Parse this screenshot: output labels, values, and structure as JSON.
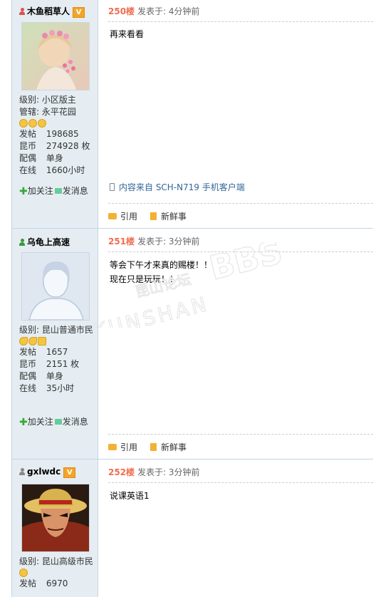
{
  "posts": [
    {
      "username": "木鱼稻草人",
      "badge": "V",
      "floor": "250楼",
      "posted": "发表于: 4分钟前",
      "content": [
        "再来看看"
      ],
      "mobile_note": "内容来自 SCH-N719 手机客户端",
      "level_label": "级别:",
      "level": "小区版主",
      "manage_label": "管辖:",
      "manage": "永平花园",
      "stats": [
        {
          "k": "发帖",
          "v": "198685"
        },
        {
          "k": "昆币",
          "v": "274928 枚"
        },
        {
          "k": "配偶",
          "v": "单身"
        },
        {
          "k": "在线",
          "v": "1660小时"
        }
      ]
    },
    {
      "username": "乌龟上高速",
      "floor": "251楼",
      "posted": "发表于: 3分钟前",
      "content": [
        "等会下午才来真的赐楼！！",
        "现在只是玩玩！！"
      ],
      "level_label": "级别:",
      "level": "昆山普通市民",
      "stats": [
        {
          "k": "发帖",
          "v": "1657"
        },
        {
          "k": "昆币",
          "v": "2151 枚"
        },
        {
          "k": "配偶",
          "v": "单身"
        },
        {
          "k": "在线",
          "v": "35小时"
        }
      ]
    },
    {
      "username": "gxlwdc",
      "badge": "V",
      "floor": "252楼",
      "posted": "发表于: 3分钟前",
      "content": [
        "说课英语1"
      ],
      "level_label": "级别:",
      "level": "昆山高级市民",
      "stats": [
        {
          "k": "发帖",
          "v": "6970"
        }
      ]
    }
  ],
  "actions": {
    "follow": "加关注",
    "message": "发消息"
  },
  "tools": {
    "quote": "引用",
    "news": "新鲜事"
  },
  "watermark": {
    "text1": "昆山论坛",
    "text2": "KUNSHAN",
    "text3": "BBS"
  },
  "colors": {
    "sidebar_bg": "#e5edf2",
    "border": "#c2d5e3",
    "floor": "#f26c4f",
    "link": "#336699"
  }
}
